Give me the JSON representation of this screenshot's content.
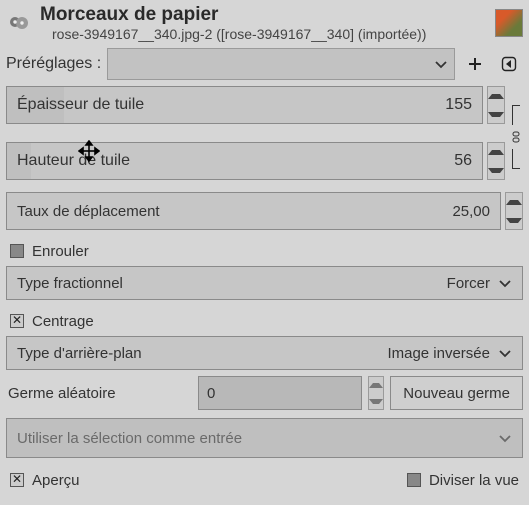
{
  "header": {
    "title": "Morceaux de papier",
    "subtitle": "rose-3949167__340.jpg-2 ([rose-3949167__340] (importée))"
  },
  "presets": {
    "label": "Préréglages :"
  },
  "tile_width": {
    "label": "Épaisseur de tuile",
    "value": "155",
    "fill_pct": 12
  },
  "tile_height": {
    "label": "Hauteur de tuile",
    "value": "56",
    "fill_pct": 5
  },
  "move_rate": {
    "label": "Taux de déplacement",
    "value": "25,00"
  },
  "wrap_label": "Enrouler",
  "fractional": {
    "label": "Type fractionnel",
    "value": "Forcer"
  },
  "center_label": "Centrage",
  "background": {
    "label": "Type d'arrière-plan",
    "value": "Image inversée"
  },
  "seed": {
    "label": "Germe aléatoire",
    "value": "0",
    "button": "Nouveau germe"
  },
  "input_sel": "Utiliser la sélection comme entrée",
  "footer": {
    "preview": "Aperçu",
    "split": "Diviser la vue"
  }
}
